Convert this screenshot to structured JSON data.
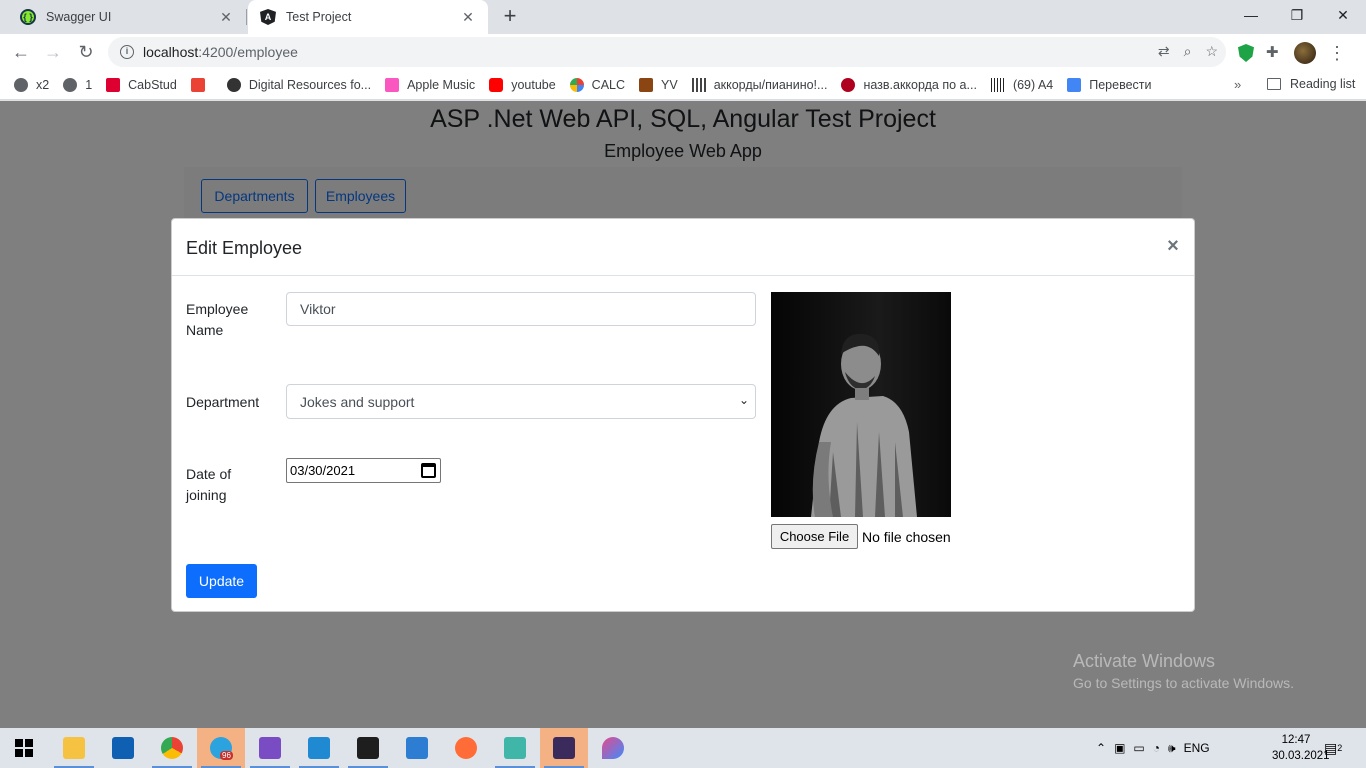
{
  "browser": {
    "tabs": [
      {
        "title": "Swagger UI",
        "active": false
      },
      {
        "title": "Test Project",
        "active": true
      }
    ],
    "new_tab": "+",
    "close_glyph": "✕",
    "window_controls": {
      "minimize": "—",
      "maximize": "❐",
      "close": "✕"
    },
    "address": {
      "host": "localhost",
      "rest": ":4200/employee"
    },
    "bookmarks": [
      {
        "label": "x2",
        "color": "#5f6368"
      },
      {
        "label": "1",
        "color": "#5f6368"
      },
      {
        "label": "CabStud",
        "color": "#dd0031"
      },
      {
        "label": "",
        "color": "#ea4335"
      },
      {
        "label": "Digital Resources fo...",
        "color": "#333333"
      },
      {
        "label": "Apple Music",
        "color": "#fa57c1"
      },
      {
        "label": "youtube",
        "color": "#ff0000"
      },
      {
        "label": "CALC",
        "color": "#34a853"
      },
      {
        "label": "YV",
        "color": "#8b4513"
      },
      {
        "label": "аккорды/пианино!...",
        "color": "#444444"
      },
      {
        "label": "назв.аккорда по а...",
        "color": "#b00020"
      },
      {
        "label": "(69) A4",
        "color": "#222222"
      },
      {
        "label": "Перевести",
        "color": "#4285f4"
      }
    ],
    "bookmarks_more": "»",
    "reading_list": "Reading list"
  },
  "page": {
    "title": "ASP .Net Web API, SQL, Angular Test Project",
    "subtitle": "Employee Web App",
    "nav": {
      "departments": "Departments",
      "employees": "Employees"
    }
  },
  "modal": {
    "title": "Edit Employee",
    "close": "×",
    "labels": {
      "name": "Employee Name",
      "department": "Department",
      "doj": "Date of joining"
    },
    "values": {
      "name": "Viktor",
      "department": "Jokes and support",
      "doj": "03/30/2021"
    },
    "file": {
      "button": "Choose File",
      "status": "No file chosen"
    },
    "submit": "Update"
  },
  "watermark": {
    "line1": "Activate Windows",
    "line2": "Go to Settings to activate Windows."
  },
  "taskbar": {
    "telegram_badge": "96",
    "language": "ENG",
    "time": "12:47",
    "date": "30.03.2021",
    "notifications": "2"
  },
  "colors": {
    "primary": "#0d6efd",
    "overlay": "rgba(0,0,0,0.5)",
    "taskbar_highlight": "#f4b183"
  }
}
